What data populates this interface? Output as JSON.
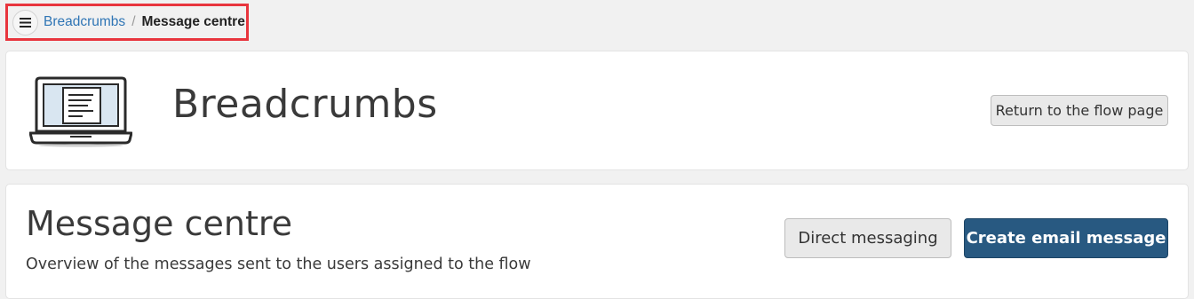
{
  "breadcrumb": {
    "menu_icon": "hamburger-menu-icon",
    "link_label": "Breadcrumbs",
    "separator": "/",
    "current": "Message centre"
  },
  "header": {
    "illustration": "laptop-document-icon",
    "title": "Breadcrumbs",
    "return_button": "Return to the flow page"
  },
  "message_centre": {
    "title": "Message centre",
    "subtitle": "Overview of the messages sent to the users assigned to the flow",
    "direct_button": "Direct messaging",
    "create_button": "Create email message"
  },
  "colors": {
    "highlight_border": "#e8353d",
    "link": "#2f75b5",
    "primary_button": "#285981",
    "background": "#f1f1f1"
  }
}
